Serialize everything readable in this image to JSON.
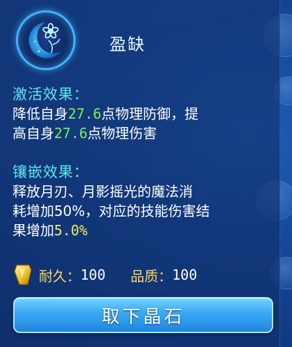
{
  "item": {
    "name": "盈缺",
    "icon": "crescent-moon-flower-icon"
  },
  "activation": {
    "heading": "激活效果：",
    "line1_pre": "降低自身",
    "line1_value": "27.6",
    "line1_post": "点物理防御，提",
    "line2_pre": "高自身",
    "line2_value": "27.6",
    "line2_post": "点物理伤害"
  },
  "inlay": {
    "heading": "镶嵌效果：",
    "line1": "释放月刃、月影摇光的魔法消",
    "line2": "耗增加50%，对应的技能伤害结",
    "line3_pre": "果增加",
    "line3_value": "5.0%"
  },
  "stats": {
    "durability_label": "耐久：",
    "durability_value": "100",
    "quality_label": "品质：",
    "quality_value": "100"
  },
  "actions": {
    "remove_label": "取下晶石"
  },
  "colors": {
    "heading": "#5fe6f0",
    "value_green": "#7cf05a",
    "value_yellow": "#f3ee5a",
    "stat_label": "#ffd85a",
    "button": "#3aa7f2"
  }
}
